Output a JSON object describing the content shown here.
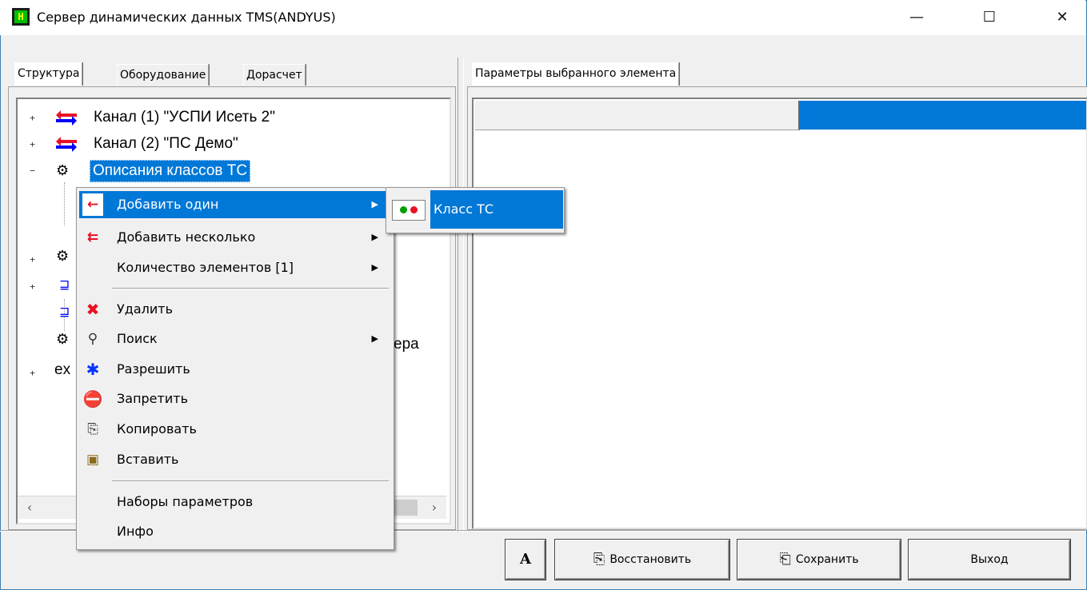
{
  "window": {
    "title": "Сервер динамических данных TMS(ANDYUS)",
    "app_icon_glyph": "H",
    "minimize": "—",
    "maximize": "☐",
    "close": "✕"
  },
  "left_tabs": [
    {
      "label": "Структура",
      "active": true
    },
    {
      "label": "Оборудование",
      "active": false
    },
    {
      "label": "Дорасчет",
      "active": false
    }
  ],
  "right_tabs": [
    {
      "label": "Параметры выбранного элемента",
      "active": true
    }
  ],
  "tree": {
    "rows": [
      {
        "expander": "+",
        "icon": "channel-arrows-icon",
        "label": "Канал  (1) \"УСПИ Исеть 2\""
      },
      {
        "expander": "+",
        "icon": "channel-arrows-icon",
        "label": "Канал  (2) \"ПС Демо\""
      },
      {
        "expander": "−",
        "icon": "gears-icon",
        "label": "Описания классов ТС",
        "selected": true
      }
    ],
    "partial": {
      "row7_text": "ера",
      "row8_text": "ex"
    }
  },
  "scroll": {
    "left": "‹",
    "right": "›"
  },
  "context_menu": {
    "items": [
      {
        "icon": "arrow-left-red-icon",
        "label": "Добавить один",
        "submenu": true,
        "highlighted": true
      },
      {
        "icon": "arrows-left-red-icon",
        "label": "Добавить несколько",
        "submenu": true
      },
      {
        "icon": "",
        "label": "Количество элементов [1]",
        "submenu": true
      },
      {
        "icon": "delete-x-icon",
        "label": "Удалить"
      },
      {
        "icon": "search-icon",
        "label": "Поиск",
        "submenu": true
      },
      {
        "icon": "allow-asterisk-icon",
        "label": "Разрешить"
      },
      {
        "icon": "forbid-icon",
        "label": "Запретить"
      },
      {
        "icon": "copy-icon",
        "label": "Копировать"
      },
      {
        "icon": "paste-icon",
        "label": "Вставить"
      },
      {
        "icon": "",
        "label": "Наборы параметров"
      },
      {
        "icon": "",
        "label": "Инфо"
      }
    ]
  },
  "submenu": {
    "item": {
      "icon": "ts-class-icon",
      "label": "Класс ТС"
    }
  },
  "buttons": {
    "font": "A",
    "restore": "Восстановить",
    "save": "Сохранить",
    "exit": "Выход"
  },
  "colors": {
    "selection": "#0078d7",
    "red_arrow": "#e81123",
    "blue_arrow": "#0000ff"
  }
}
